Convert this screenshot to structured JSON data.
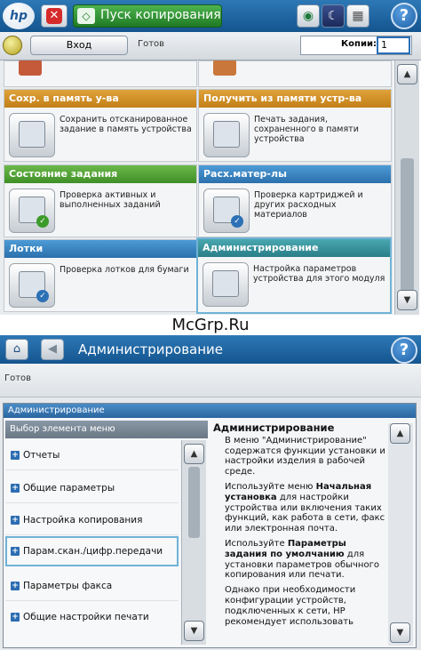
{
  "top_panel": {
    "logo_text": "hp",
    "start_copy_label": "Пуск копирования",
    "stop_icon": "stop-icon",
    "status": {
      "login_label": "Вход",
      "state": "Готов",
      "copies_label": "Копии:",
      "copies_value": "1"
    },
    "tiles": [
      {
        "header": "Сохр. в память у-ва",
        "desc": "Сохранить отсканированное задание в память устройства",
        "color": "#d08f25"
      },
      {
        "header": "Получить из памяти устр-ва",
        "desc": "Печать задания, сохраненного в памяти устройства",
        "color": "#d08f25"
      },
      {
        "header": "Состояние задания",
        "desc": "Проверка активных и выполненных заданий",
        "color": "#52a43a"
      },
      {
        "header": "Расх.матер-лы",
        "desc": "Проверка картриджей и других расходных материалов",
        "color": "#3b86c3"
      },
      {
        "header": "Лотки",
        "desc": "Проверка лотков для бумаги",
        "color": "#3b86c3"
      },
      {
        "header": "Администрирование",
        "desc": "Настройка параметров устройства для этого модуля",
        "color": "#3a93a0"
      }
    ]
  },
  "watermark": "McGrp.Ru",
  "bottom_panel": {
    "title": "Администрирование",
    "state": "Готов",
    "frame_title": "Администрирование",
    "menu_header": "Выбор элемента меню",
    "menu_items": [
      {
        "label": "Отчеты"
      },
      {
        "label": "Общие параметры"
      },
      {
        "label": "Настройка копирования"
      },
      {
        "label": "Парам.скан./цифр.передачи"
      },
      {
        "label": "Параметры факса"
      },
      {
        "label": "Общие настройки печати"
      }
    ],
    "info": {
      "title": "Администрирование",
      "p1": "В меню \"Администрирование\" содержатся функции установки и настройки изделия в рабочей среде.",
      "p2a": "Используйте меню ",
      "p2b": "Начальная установка",
      "p2c": " для настройки устройства или включения таких функций, как работа в сети, факс или электронная почта.",
      "p3a": "Используйте ",
      "p3b": "Параметры задания по умолчанию",
      "p3c": " для установки параметров обычного копирования или печати.",
      "p4": "Однако при необходимости конфигурации устройств, подключенных к сети, HP рекомендует использовать"
    }
  }
}
